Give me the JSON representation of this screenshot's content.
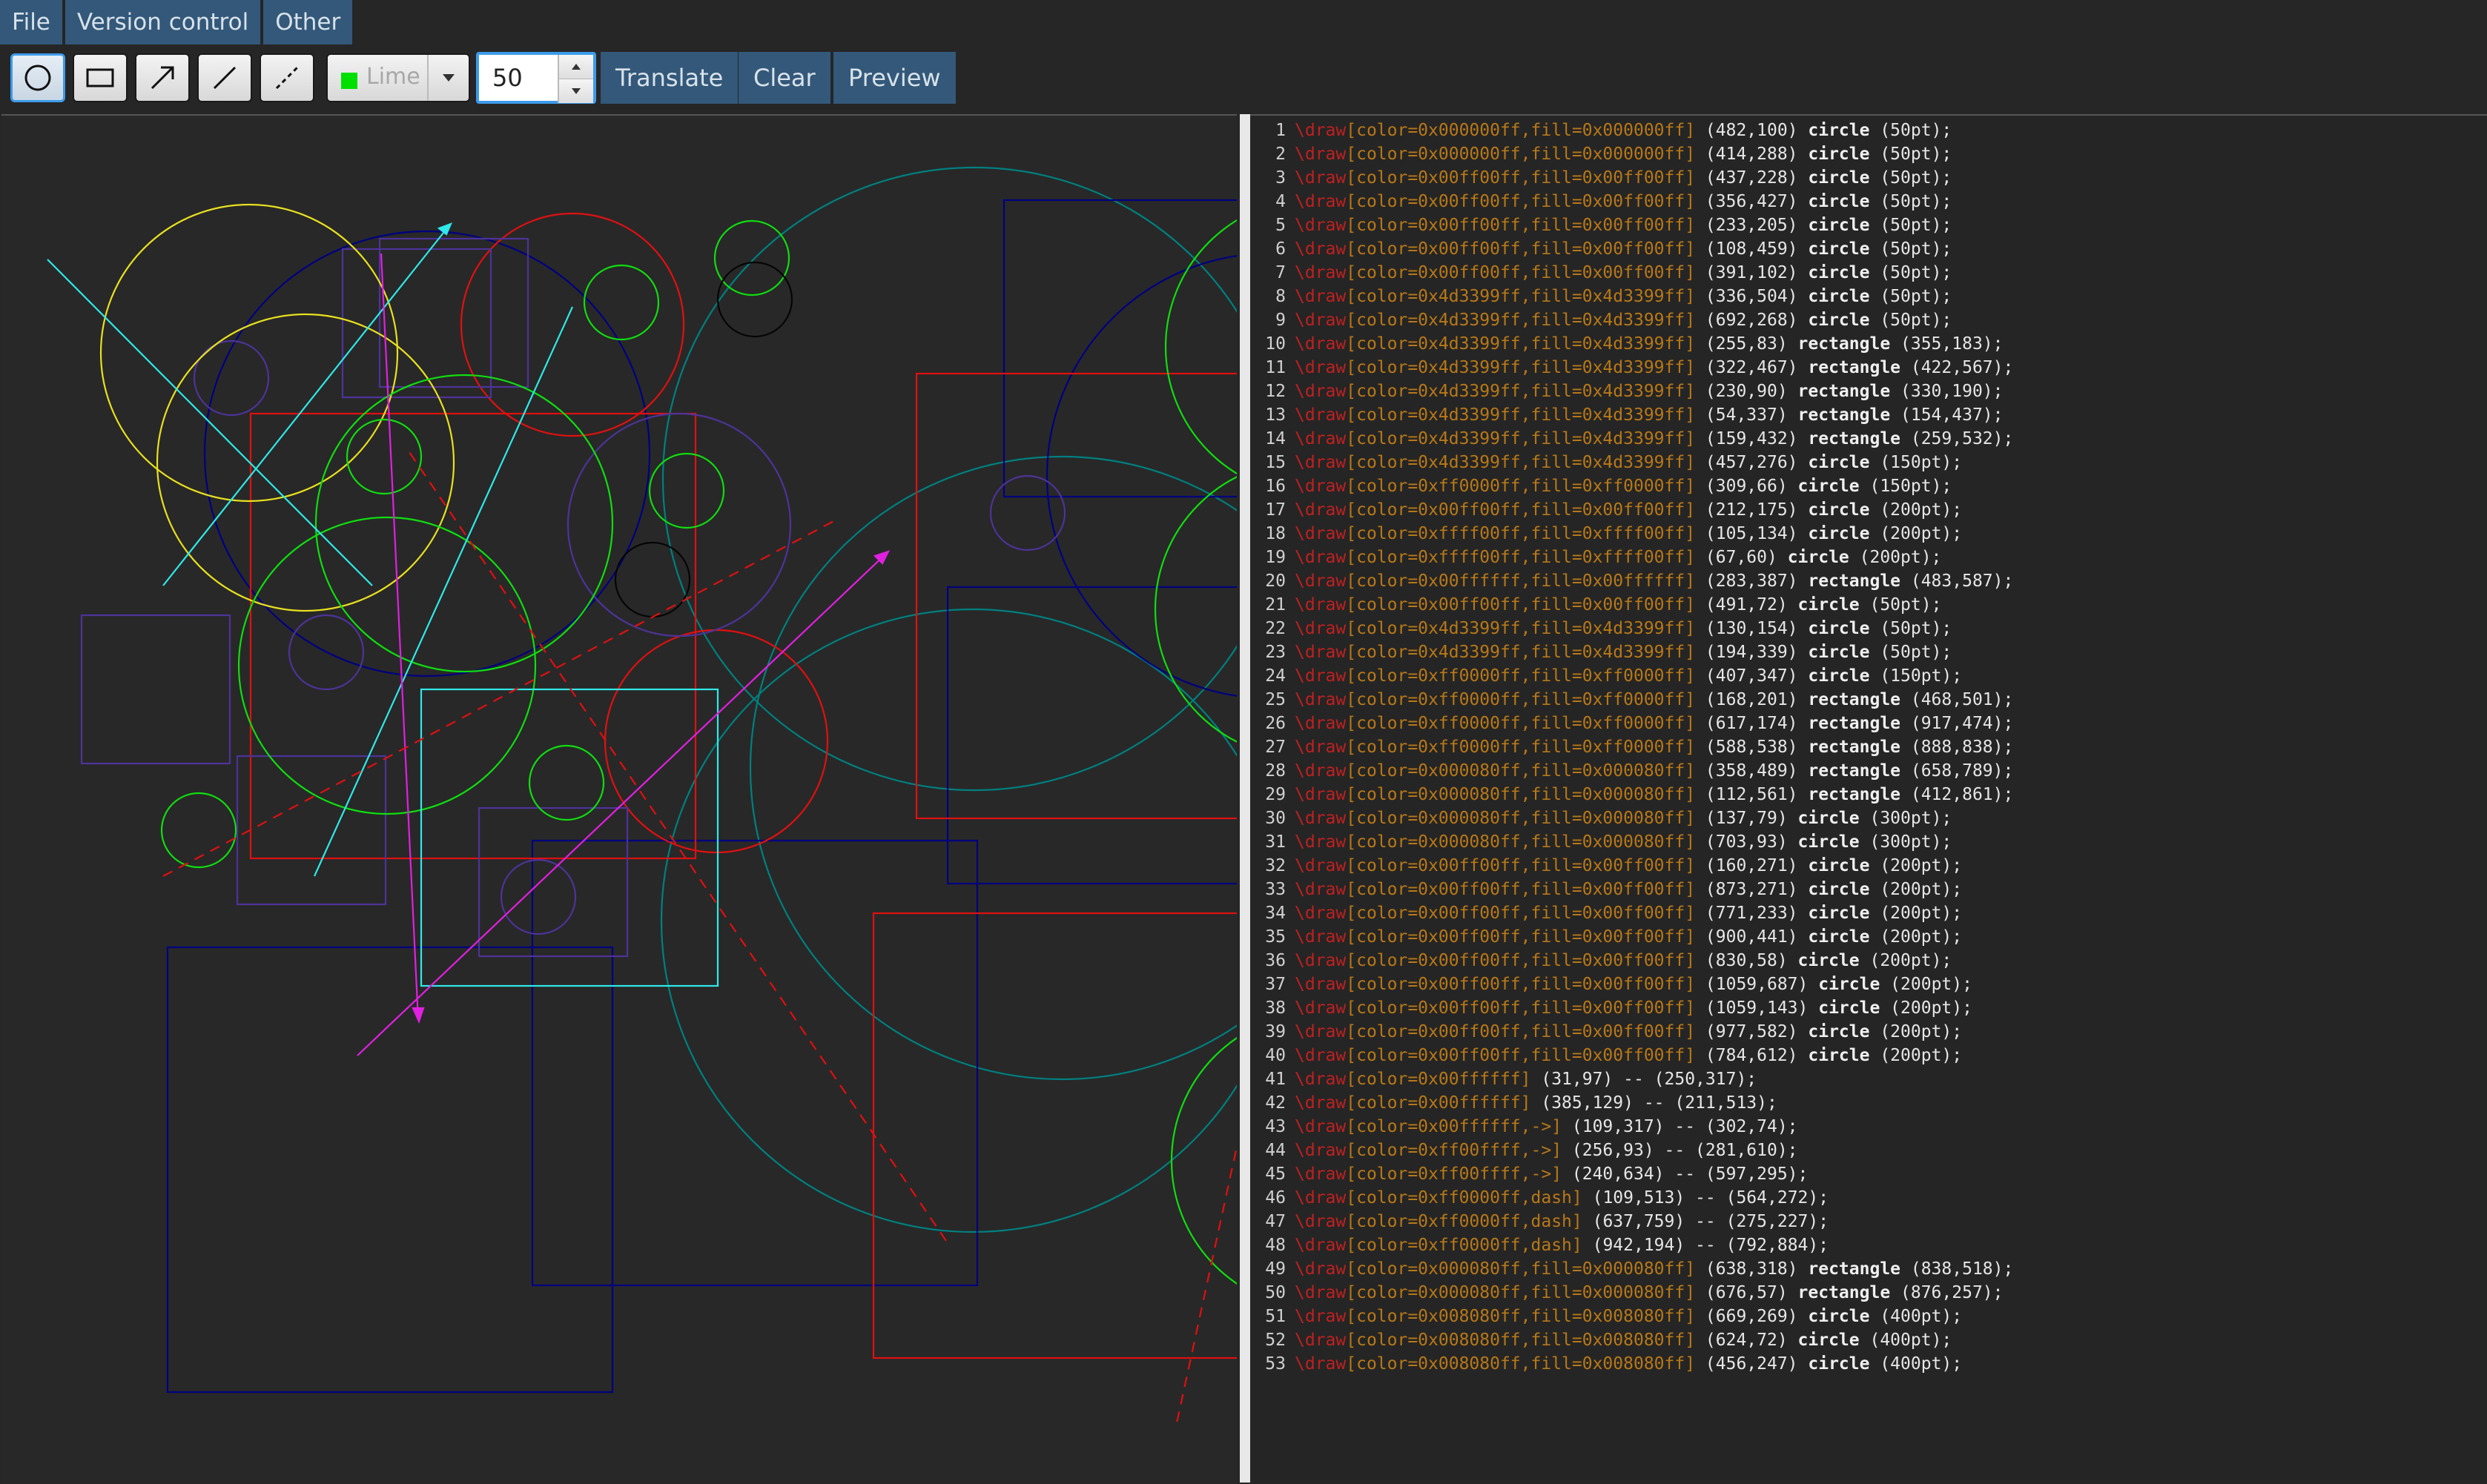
{
  "menubar": {
    "items": [
      "File",
      "Version control",
      "Other"
    ]
  },
  "toolbar": {
    "tools": [
      {
        "name": "circle-tool",
        "icon": "circle-icon",
        "active": true
      },
      {
        "name": "rectangle-tool",
        "icon": "rectangle-icon",
        "active": false
      },
      {
        "name": "arrow-tool",
        "icon": "arrow-icon",
        "active": false
      },
      {
        "name": "line-tool",
        "icon": "line-icon",
        "active": false
      },
      {
        "name": "dashed-line-tool",
        "icon": "dashed-line-icon",
        "active": false
      }
    ],
    "color_label": "Lime",
    "color_swatch": "#00e000",
    "size_value": "50",
    "translate_label": "Translate",
    "clear_label": "Clear",
    "preview_label": "Preview"
  },
  "editor": {
    "lines": [
      {
        "n": "1",
        "kw": "\\draw",
        "opt": "[color=0x000000ff,fill=0x000000ff]",
        "rest": " (482,100) ",
        "shape": "circle",
        "tail": " (50pt);"
      },
      {
        "n": "2",
        "kw": "\\draw",
        "opt": "[color=0x000000ff,fill=0x000000ff]",
        "rest": " (414,288) ",
        "shape": "circle",
        "tail": " (50pt);"
      },
      {
        "n": "3",
        "kw": "\\draw",
        "opt": "[color=0x00ff00ff,fill=0x00ff00ff]",
        "rest": " (437,228) ",
        "shape": "circle",
        "tail": " (50pt);"
      },
      {
        "n": "4",
        "kw": "\\draw",
        "opt": "[color=0x00ff00ff,fill=0x00ff00ff]",
        "rest": " (356,427) ",
        "shape": "circle",
        "tail": " (50pt);"
      },
      {
        "n": "5",
        "kw": "\\draw",
        "opt": "[color=0x00ff00ff,fill=0x00ff00ff]",
        "rest": " (233,205) ",
        "shape": "circle",
        "tail": " (50pt);"
      },
      {
        "n": "6",
        "kw": "\\draw",
        "opt": "[color=0x00ff00ff,fill=0x00ff00ff]",
        "rest": " (108,459) ",
        "shape": "circle",
        "tail": " (50pt);"
      },
      {
        "n": "7",
        "kw": "\\draw",
        "opt": "[color=0x00ff00ff,fill=0x00ff00ff]",
        "rest": " (391,102) ",
        "shape": "circle",
        "tail": " (50pt);"
      },
      {
        "n": "8",
        "kw": "\\draw",
        "opt": "[color=0x4d3399ff,fill=0x4d3399ff]",
        "rest": " (336,504) ",
        "shape": "circle",
        "tail": " (50pt);"
      },
      {
        "n": "9",
        "kw": "\\draw",
        "opt": "[color=0x4d3399ff,fill=0x4d3399ff]",
        "rest": " (692,268) ",
        "shape": "circle",
        "tail": " (50pt);"
      },
      {
        "n": "10",
        "kw": "\\draw",
        "opt": "[color=0x4d3399ff,fill=0x4d3399ff]",
        "rest": " (255,83) ",
        "shape": "rectangle",
        "tail": " (355,183);"
      },
      {
        "n": "11",
        "kw": "\\draw",
        "opt": "[color=0x4d3399ff,fill=0x4d3399ff]",
        "rest": " (322,467) ",
        "shape": "rectangle",
        "tail": " (422,567);"
      },
      {
        "n": "12",
        "kw": "\\draw",
        "opt": "[color=0x4d3399ff,fill=0x4d3399ff]",
        "rest": " (230,90) ",
        "shape": "rectangle",
        "tail": " (330,190);"
      },
      {
        "n": "13",
        "kw": "\\draw",
        "opt": "[color=0x4d3399ff,fill=0x4d3399ff]",
        "rest": " (54,337) ",
        "shape": "rectangle",
        "tail": " (154,437);"
      },
      {
        "n": "14",
        "kw": "\\draw",
        "opt": "[color=0x4d3399ff,fill=0x4d3399ff]",
        "rest": " (159,432) ",
        "shape": "rectangle",
        "tail": " (259,532);"
      },
      {
        "n": "15",
        "kw": "\\draw",
        "opt": "[color=0x4d3399ff,fill=0x4d3399ff]",
        "rest": " (457,276) ",
        "shape": "circle",
        "tail": " (150pt);"
      },
      {
        "n": "16",
        "kw": "\\draw",
        "opt": "[color=0xff0000ff,fill=0xff0000ff]",
        "rest": " (309,66) ",
        "shape": "circle",
        "tail": " (150pt);"
      },
      {
        "n": "17",
        "kw": "\\draw",
        "opt": "[color=0x00ff00ff,fill=0x00ff00ff]",
        "rest": " (212,175) ",
        "shape": "circle",
        "tail": " (200pt);"
      },
      {
        "n": "18",
        "kw": "\\draw",
        "opt": "[color=0xffff00ff,fill=0xffff00ff]",
        "rest": " (105,134) ",
        "shape": "circle",
        "tail": " (200pt);"
      },
      {
        "n": "19",
        "kw": "\\draw",
        "opt": "[color=0xffff00ff,fill=0xffff00ff]",
        "rest": " (67,60) ",
        "shape": "circle",
        "tail": " (200pt);"
      },
      {
        "n": "20",
        "kw": "\\draw",
        "opt": "[color=0x00ffffff,fill=0x00ffffff]",
        "rest": " (283,387) ",
        "shape": "rectangle",
        "tail": " (483,587);"
      },
      {
        "n": "21",
        "kw": "\\draw",
        "opt": "[color=0x00ff00ff,fill=0x00ff00ff]",
        "rest": " (491,72) ",
        "shape": "circle",
        "tail": " (50pt);"
      },
      {
        "n": "22",
        "kw": "\\draw",
        "opt": "[color=0x4d3399ff,fill=0x4d3399ff]",
        "rest": " (130,154) ",
        "shape": "circle",
        "tail": " (50pt);"
      },
      {
        "n": "23",
        "kw": "\\draw",
        "opt": "[color=0x4d3399ff,fill=0x4d3399ff]",
        "rest": " (194,339) ",
        "shape": "circle",
        "tail": " (50pt);"
      },
      {
        "n": "24",
        "kw": "\\draw",
        "opt": "[color=0xff0000ff,fill=0xff0000ff]",
        "rest": " (407,347) ",
        "shape": "circle",
        "tail": " (150pt);"
      },
      {
        "n": "25",
        "kw": "\\draw",
        "opt": "[color=0xff0000ff,fill=0xff0000ff]",
        "rest": " (168,201) ",
        "shape": "rectangle",
        "tail": " (468,501);"
      },
      {
        "n": "26",
        "kw": "\\draw",
        "opt": "[color=0xff0000ff,fill=0xff0000ff]",
        "rest": " (617,174) ",
        "shape": "rectangle",
        "tail": " (917,474);"
      },
      {
        "n": "27",
        "kw": "\\draw",
        "opt": "[color=0xff0000ff,fill=0xff0000ff]",
        "rest": " (588,538) ",
        "shape": "rectangle",
        "tail": " (888,838);"
      },
      {
        "n": "28",
        "kw": "\\draw",
        "opt": "[color=0x000080ff,fill=0x000080ff]",
        "rest": " (358,489) ",
        "shape": "rectangle",
        "tail": " (658,789);"
      },
      {
        "n": "29",
        "kw": "\\draw",
        "opt": "[color=0x000080ff,fill=0x000080ff]",
        "rest": " (112,561) ",
        "shape": "rectangle",
        "tail": " (412,861);"
      },
      {
        "n": "30",
        "kw": "\\draw",
        "opt": "[color=0x000080ff,fill=0x000080ff]",
        "rest": " (137,79) ",
        "shape": "circle",
        "tail": " (300pt);"
      },
      {
        "n": "31",
        "kw": "\\draw",
        "opt": "[color=0x000080ff,fill=0x000080ff]",
        "rest": " (703,93) ",
        "shape": "circle",
        "tail": " (300pt);"
      },
      {
        "n": "32",
        "kw": "\\draw",
        "opt": "[color=0x00ff00ff,fill=0x00ff00ff]",
        "rest": " (160,271) ",
        "shape": "circle",
        "tail": " (200pt);"
      },
      {
        "n": "33",
        "kw": "\\draw",
        "opt": "[color=0x00ff00ff,fill=0x00ff00ff]",
        "rest": " (873,271) ",
        "shape": "circle",
        "tail": " (200pt);"
      },
      {
        "n": "34",
        "kw": "\\draw",
        "opt": "[color=0x00ff00ff,fill=0x00ff00ff]",
        "rest": " (771,233) ",
        "shape": "circle",
        "tail": " (200pt);"
      },
      {
        "n": "35",
        "kw": "\\draw",
        "opt": "[color=0x00ff00ff,fill=0x00ff00ff]",
        "rest": " (900,441) ",
        "shape": "circle",
        "tail": " (200pt);"
      },
      {
        "n": "36",
        "kw": "\\draw",
        "opt": "[color=0x00ff00ff,fill=0x00ff00ff]",
        "rest": " (830,58) ",
        "shape": "circle",
        "tail": " (200pt);"
      },
      {
        "n": "37",
        "kw": "\\draw",
        "opt": "[color=0x00ff00ff,fill=0x00ff00ff]",
        "rest": " (1059,687) ",
        "shape": "circle",
        "tail": " (200pt);"
      },
      {
        "n": "38",
        "kw": "\\draw",
        "opt": "[color=0x00ff00ff,fill=0x00ff00ff]",
        "rest": " (1059,143) ",
        "shape": "circle",
        "tail": " (200pt);"
      },
      {
        "n": "39",
        "kw": "\\draw",
        "opt": "[color=0x00ff00ff,fill=0x00ff00ff]",
        "rest": " (977,582) ",
        "shape": "circle",
        "tail": " (200pt);"
      },
      {
        "n": "40",
        "kw": "\\draw",
        "opt": "[color=0x00ff00ff,fill=0x00ff00ff]",
        "rest": " (784,612) ",
        "shape": "circle",
        "tail": " (200pt);"
      },
      {
        "n": "41",
        "kw": "\\draw",
        "opt": "[color=0x00ffffff]",
        "rest": " (31,97) -- (250,317);",
        "shape": "",
        "tail": ""
      },
      {
        "n": "42",
        "kw": "\\draw",
        "opt": "[color=0x00ffffff]",
        "rest": " (385,129) -- (211,513);",
        "shape": "",
        "tail": ""
      },
      {
        "n": "43",
        "kw": "\\draw",
        "opt": "[color=0x00ffffff,->]",
        "rest": " (109,317) -- (302,74);",
        "shape": "",
        "tail": ""
      },
      {
        "n": "44",
        "kw": "\\draw",
        "opt": "[color=0xff00ffff,->]",
        "rest": " (256,93) -- (281,610);",
        "shape": "",
        "tail": ""
      },
      {
        "n": "45",
        "kw": "\\draw",
        "opt": "[color=0xff00ffff,->]",
        "rest": " (240,634) -- (597,295);",
        "shape": "",
        "tail": ""
      },
      {
        "n": "46",
        "kw": "\\draw",
        "opt": "[color=0xff0000ff,dash]",
        "rest": " (109,513) -- (564,272);",
        "shape": "",
        "tail": ""
      },
      {
        "n": "47",
        "kw": "\\draw",
        "opt": "[color=0xff0000ff,dash]",
        "rest": " (637,759) -- (275,227);",
        "shape": "",
        "tail": ""
      },
      {
        "n": "48",
        "kw": "\\draw",
        "opt": "[color=0xff0000ff,dash]",
        "rest": " (942,194) -- (792,884);",
        "shape": "",
        "tail": ""
      },
      {
        "n": "49",
        "kw": "\\draw",
        "opt": "[color=0x000080ff,fill=0x000080ff]",
        "rest": " (638,318) ",
        "shape": "rectangle",
        "tail": " (838,518);"
      },
      {
        "n": "50",
        "kw": "\\draw",
        "opt": "[color=0x000080ff,fill=0x000080ff]",
        "rest": " (676,57) ",
        "shape": "rectangle",
        "tail": " (876,257);"
      },
      {
        "n": "51",
        "kw": "\\draw",
        "opt": "[color=0x008080ff,fill=0x008080ff]",
        "rest": " (669,269) ",
        "shape": "circle",
        "tail": " (400pt);"
      },
      {
        "n": "52",
        "kw": "\\draw",
        "opt": "[color=0x008080ff,fill=0x008080ff]",
        "rest": " (624,72) ",
        "shape": "circle",
        "tail": " (400pt);"
      },
      {
        "n": "53",
        "kw": "\\draw",
        "opt": "[color=0x008080ff,fill=0x008080ff]",
        "rest": " (456,247) ",
        "shape": "circle",
        "tail": " (400pt);"
      }
    ]
  }
}
